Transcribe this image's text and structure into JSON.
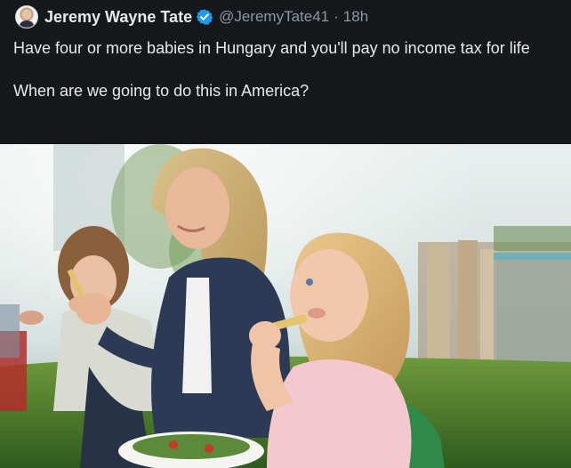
{
  "tweet": {
    "author_name": "Jeremy Wayne Tate",
    "handle": "@JeremyTate41",
    "separator": "·",
    "time": "18h",
    "text": "Have four or more babies in Hungary and you'll pay no income tax for life\n\nWhen are we going to do this in America?"
  },
  "icons": {
    "verified": "verified-badge-icon"
  },
  "colors": {
    "background": "#16181c",
    "text": "#e7e9ea",
    "secondary_text": "#8b98a5",
    "verified": "#1d9bf0"
  }
}
